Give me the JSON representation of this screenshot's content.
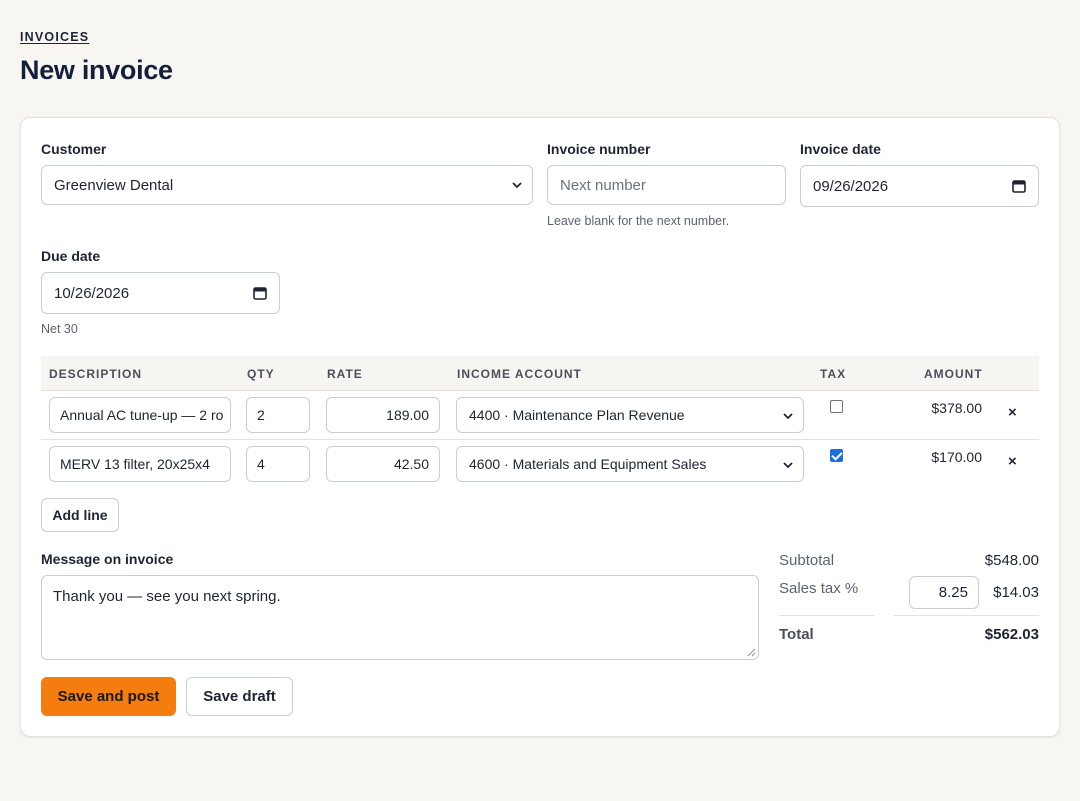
{
  "breadcrumb": "INVOICES",
  "page_title": "New invoice",
  "customer": {
    "label": "Customer",
    "value": "Greenview Dental"
  },
  "invoice_number": {
    "label": "Invoice number",
    "placeholder": "Next number",
    "hint": "Leave blank for the next number."
  },
  "invoice_date": {
    "label": "Invoice date",
    "value": "09/26/2026"
  },
  "due_date": {
    "label": "Due date",
    "value": "10/26/2026",
    "hint": "Net 30"
  },
  "table": {
    "headers": {
      "description": "DESCRIPTION",
      "qty": "QTY",
      "rate": "RATE",
      "income_account": "INCOME ACCOUNT",
      "tax": "TAX",
      "amount": "AMOUNT"
    },
    "rows": [
      {
        "description": "Annual AC tune-up — 2 ro",
        "qty": "2",
        "rate": "189.00",
        "income_account": "4400 · Maintenance Plan Revenue",
        "tax": false,
        "amount": "$378.00",
        "remove": "×"
      },
      {
        "description": "MERV 13 filter, 20x25x4",
        "qty": "4",
        "rate": "42.50",
        "income_account": "4600 · Materials and Equipment Sales",
        "tax": true,
        "amount": "$170.00",
        "remove": "×"
      }
    ]
  },
  "add_line_label": "Add line",
  "message": {
    "label": "Message on invoice",
    "value": "Thank you — see you next spring."
  },
  "summary": {
    "subtotal_label": "Subtotal",
    "subtotal_value": "$548.00",
    "tax_label": "Sales tax %",
    "tax_rate": "8.25",
    "tax_value": "$14.03",
    "total_label": "Total",
    "total_value": "$562.03"
  },
  "actions": {
    "save_post": "Save and post",
    "save_draft": "Save draft"
  },
  "colors": {
    "accent": "#f57c0f",
    "checkbox": "#1a6fe0",
    "page_bg": "#f7f6f3"
  }
}
